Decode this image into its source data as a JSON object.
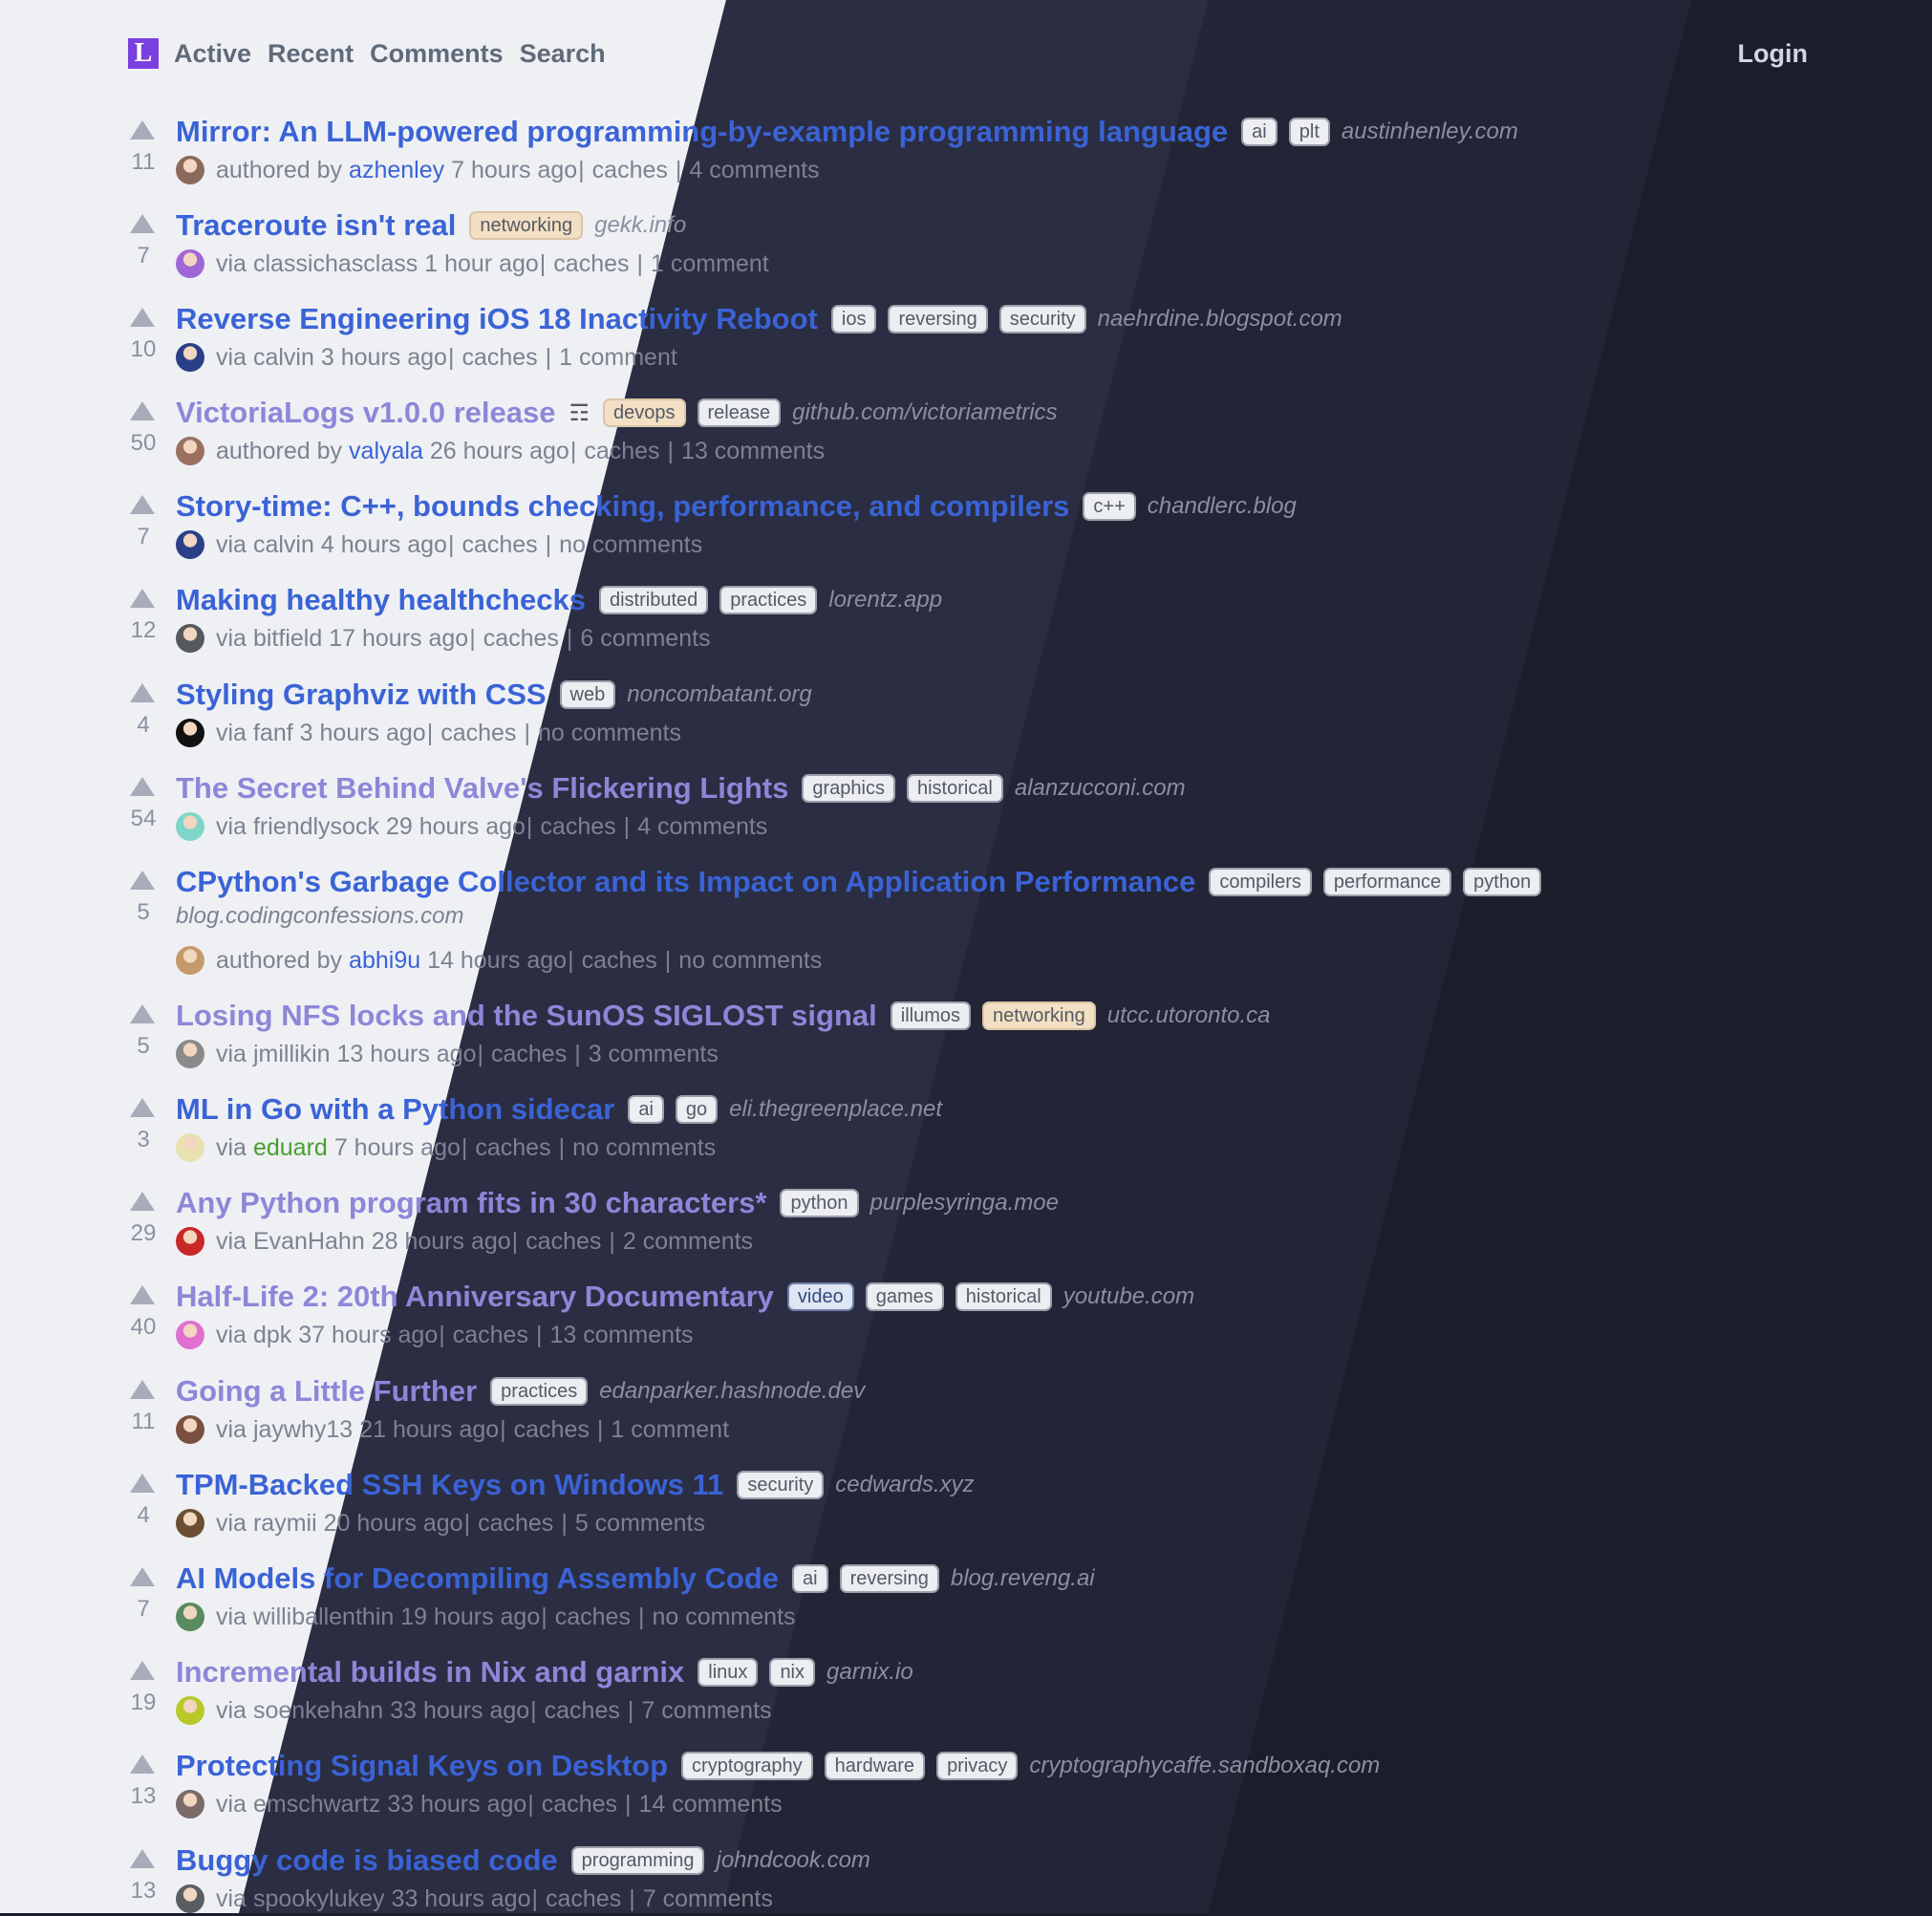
{
  "brand": {
    "logo_letter": "L",
    "logo_color": "#7b3fe0"
  },
  "nav": {
    "items": [
      "Active",
      "Recent",
      "Comments",
      "Search"
    ],
    "login": "Login"
  },
  "colors": {
    "link": "#3a63d6",
    "visited": "#8e86d8",
    "bg_light": "#eff0f4",
    "bg_dark": "#1c1d2a"
  },
  "stories": [
    {
      "score": "11",
      "title": "Mirror: An LLM-powered programming-by-example programming language",
      "visited": false,
      "tags": [
        "ai",
        "plt"
      ],
      "domain": "austinhenley.com",
      "kind": "authored by",
      "user": "azhenley",
      "user_style": "link",
      "time": "7 hours ago",
      "caches": "caches",
      "comments": "4 comments",
      "avatar": "#8a6a5a"
    },
    {
      "score": "7",
      "title": "Traceroute isn't real",
      "visited": false,
      "tags": [
        "networking"
      ],
      "domain": "gekk.info",
      "kind": "via",
      "user": "classichasclass",
      "user_style": "plain",
      "time": "1 hour ago",
      "caches": "caches",
      "comments": "1 comment",
      "avatar": "#a066d8"
    },
    {
      "score": "10",
      "title": "Reverse Engineering iOS 18 Inactivity Reboot",
      "visited": false,
      "tags": [
        "ios",
        "reversing",
        "security"
      ],
      "domain": "naehrdine.blogspot.com",
      "kind": "via",
      "user": "calvin",
      "user_style": "plain",
      "time": "3 hours ago",
      "caches": "caches",
      "comments": "1 comment",
      "avatar": "#2a3f88"
    },
    {
      "score": "50",
      "title": "VictoriaLogs v1.0.0 release",
      "visited": true,
      "doc_icon": "☶",
      "tags": [
        "devops",
        "release"
      ],
      "domain": "github.com/victoriametrics",
      "kind": "authored by",
      "user": "valyala",
      "user_style": "link",
      "time": "26 hours ago",
      "caches": "caches",
      "comments": "13 comments",
      "avatar": "#9a7060"
    },
    {
      "score": "7",
      "title": "Story-time: C++, bounds checking, performance, and compilers",
      "visited": false,
      "tags": [
        "c++"
      ],
      "domain": "chandlerc.blog",
      "kind": "via",
      "user": "calvin",
      "user_style": "plain",
      "time": "4 hours ago",
      "caches": "caches",
      "comments": "no comments",
      "avatar": "#2a3f88"
    },
    {
      "score": "12",
      "title": "Making healthy healthchecks",
      "visited": false,
      "tags": [
        "distributed",
        "practices"
      ],
      "domain": "lorentz.app",
      "kind": "via",
      "user": "bitfield",
      "user_style": "plain",
      "time": "17 hours ago",
      "caches": "caches",
      "comments": "6 comments",
      "avatar": "#55585e"
    },
    {
      "score": "4",
      "title": "Styling Graphviz with CSS",
      "visited": false,
      "tags": [
        "web"
      ],
      "domain": "noncombatant.org",
      "kind": "via",
      "user": "fanf",
      "user_style": "plain",
      "time": "3 hours ago",
      "caches": "caches",
      "comments": "no comments",
      "avatar": "#111111"
    },
    {
      "score": "54",
      "title": "The Secret Behind Valve's Flickering Lights",
      "visited": true,
      "tags": [
        "graphics",
        "historical"
      ],
      "domain": "alanzucconi.com",
      "kind": "via",
      "user": "friendlysock",
      "user_style": "plain",
      "time": "29 hours ago",
      "caches": "caches",
      "comments": "4 comments",
      "avatar": "#7fd6c8"
    },
    {
      "score": "5",
      "title": "CPython's Garbage Collector and its Impact on Application Performance",
      "visited": false,
      "tags": [
        "compilers",
        "performance",
        "python"
      ],
      "domain": "blog.codingconfessions.com",
      "kind": "authored by",
      "user": "abhi9u",
      "user_style": "link",
      "time": "14 hours ago",
      "caches": "caches",
      "comments": "no comments",
      "avatar": "#c49a6a"
    },
    {
      "score": "5",
      "title": "Losing NFS locks and the SunOS SIGLOST signal",
      "visited": true,
      "tags": [
        "illumos",
        "networking"
      ],
      "domain": "utcc.utoronto.ca",
      "kind": "via",
      "user": "jmillikin",
      "user_style": "plain",
      "time": "13 hours ago",
      "caches": "caches",
      "comments": "3 comments",
      "avatar": "#8a8a8a"
    },
    {
      "score": "3",
      "title": "ML in Go with a Python sidecar",
      "visited": false,
      "tags": [
        "ai",
        "go"
      ],
      "domain": "eli.thegreenplace.net",
      "kind": "via",
      "user": "eduard",
      "user_style": "green",
      "time": "7 hours ago",
      "caches": "caches",
      "comments": "no comments",
      "avatar": "#e8e2b0"
    },
    {
      "score": "29",
      "title": "Any Python program fits in 30 characters*",
      "visited": true,
      "tags": [
        "python"
      ],
      "domain": "purplesyringa.moe",
      "kind": "via",
      "user": "EvanHahn",
      "user_style": "plain",
      "time": "28 hours ago",
      "caches": "caches",
      "comments": "2 comments",
      "avatar": "#c82828"
    },
    {
      "score": "40",
      "title": "Half-Life 2: 20th Anniversary Documentary",
      "visited": true,
      "tags": [
        "video",
        "games",
        "historical"
      ],
      "domain": "youtube.com",
      "kind": "via",
      "user": "dpk",
      "user_style": "plain",
      "time": "37 hours ago",
      "caches": "caches",
      "comments": "13 comments",
      "avatar": "#e070d0"
    },
    {
      "score": "11",
      "title": "Going a Little Further",
      "visited": true,
      "tags": [
        "practices"
      ],
      "domain": "edanparker.hashnode.dev",
      "kind": "via",
      "user": "jaywhy13",
      "user_style": "plain",
      "time": "21 hours ago",
      "caches": "caches",
      "comments": "1 comment",
      "avatar": "#7a5040"
    },
    {
      "score": "4",
      "title": "TPM-Backed SSH Keys on Windows 11",
      "visited": false,
      "tags": [
        "security"
      ],
      "domain": "cedwards.xyz",
      "kind": "via",
      "user": "raymii",
      "user_style": "plain",
      "time": "20 hours ago",
      "caches": "caches",
      "comments": "5 comments",
      "avatar": "#6a5030"
    },
    {
      "score": "7",
      "title": "AI Models for Decompiling Assembly Code",
      "visited": false,
      "tags": [
        "ai",
        "reversing"
      ],
      "domain": "blog.reveng.ai",
      "kind": "via",
      "user": "williballenthin",
      "user_style": "plain",
      "time": "19 hours ago",
      "caches": "caches",
      "comments": "no comments",
      "avatar": "#5a8a60"
    },
    {
      "score": "19",
      "title": "Incremental builds in Nix and garnix",
      "visited": true,
      "tags": [
        "linux",
        "nix"
      ],
      "domain": "garnix.io",
      "kind": "via",
      "user": "soenkehahn",
      "user_style": "plain",
      "time": "33 hours ago",
      "caches": "caches",
      "comments": "7 comments",
      "avatar": "#b8c828"
    },
    {
      "score": "13",
      "title": "Protecting Signal Keys on Desktop",
      "visited": false,
      "tags": [
        "cryptography",
        "hardware",
        "privacy"
      ],
      "domain": "cryptographycaffe.sandboxaq.com",
      "kind": "via",
      "user": "emschwartz",
      "user_style": "plain",
      "time": "33 hours ago",
      "caches": "caches",
      "comments": "14 comments",
      "avatar": "#7a6a68"
    },
    {
      "score": "13",
      "title": "Buggy code is biased code",
      "visited": false,
      "tags": [
        "programming"
      ],
      "domain": "johndcook.com",
      "kind": "via",
      "user": "spookylukey",
      "user_style": "plain",
      "time": "33 hours ago",
      "caches": "caches",
      "comments": "7 comments",
      "avatar": "#5a5e64"
    }
  ]
}
